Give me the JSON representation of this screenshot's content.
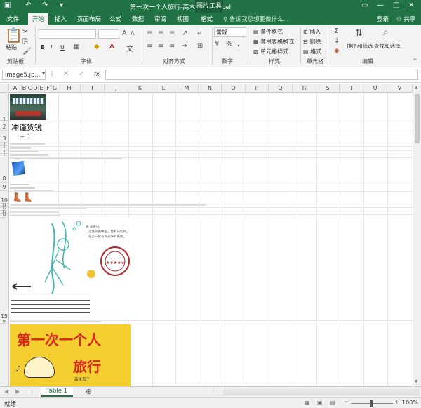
{
  "app": {
    "title": "第一次一个人旅行-高木直子 - Excel",
    "context_tab": "图片工具",
    "login": "登录",
    "share": "共享"
  },
  "tabs": [
    "文件",
    "开始",
    "插入",
    "页面布局",
    "公式",
    "数据",
    "审阅",
    "视图",
    "格式"
  ],
  "active_tab": "开始",
  "tell_me": "告诉我您想要做什么...",
  "ribbon": {
    "groups": [
      "剪贴板",
      "字体",
      "对齐方式",
      "数字",
      "样式",
      "单元格",
      "编辑"
    ],
    "paste": "粘贴",
    "number_format": "常规",
    "styles": [
      "条件格式",
      "套用表格格式",
      "单元格样式"
    ],
    "cells": [
      "插入",
      "删除",
      "格式"
    ],
    "editing": [
      "排序和筛选",
      "查找和选择"
    ],
    "font_buttons": [
      "B",
      "I",
      "U"
    ]
  },
  "formula_bar": {
    "name_box": "image5.jp...",
    "fx": "fx"
  },
  "columns": [
    "A",
    "B",
    "C",
    "D",
    "E",
    "F",
    "G",
    "H",
    "I",
    "J",
    "K",
    "L",
    "M",
    "N",
    "O",
    "P",
    "Q",
    "R",
    "S",
    "T",
    "U",
    "V"
  ],
  "rows": [
    "1",
    "2",
    "3",
    "4",
    "5",
    "6",
    "7",
    "8",
    "9",
    "10",
    "11",
    "12",
    "13",
    "14",
    "15",
    "16"
  ],
  "cells": {
    "title_cell": "冲谨货镜",
    "artwork": {
      "stamp_text": "★★★★★",
      "note1": "确  去条讯。",
      "note2": "过亮美路中国，世有日切有。",
      "note3": "在走一提有完美快的再明。",
      "cover_title_1": "第一次一个人",
      "cover_title_2": "旅行",
      "cover_author": "高木直子"
    }
  },
  "sheet_tab": "Table 1",
  "status": "就绪",
  "zoom": "100%",
  "colors": {
    "excel_green": "#217346",
    "ribbon_bg": "#f3f3f3"
  }
}
